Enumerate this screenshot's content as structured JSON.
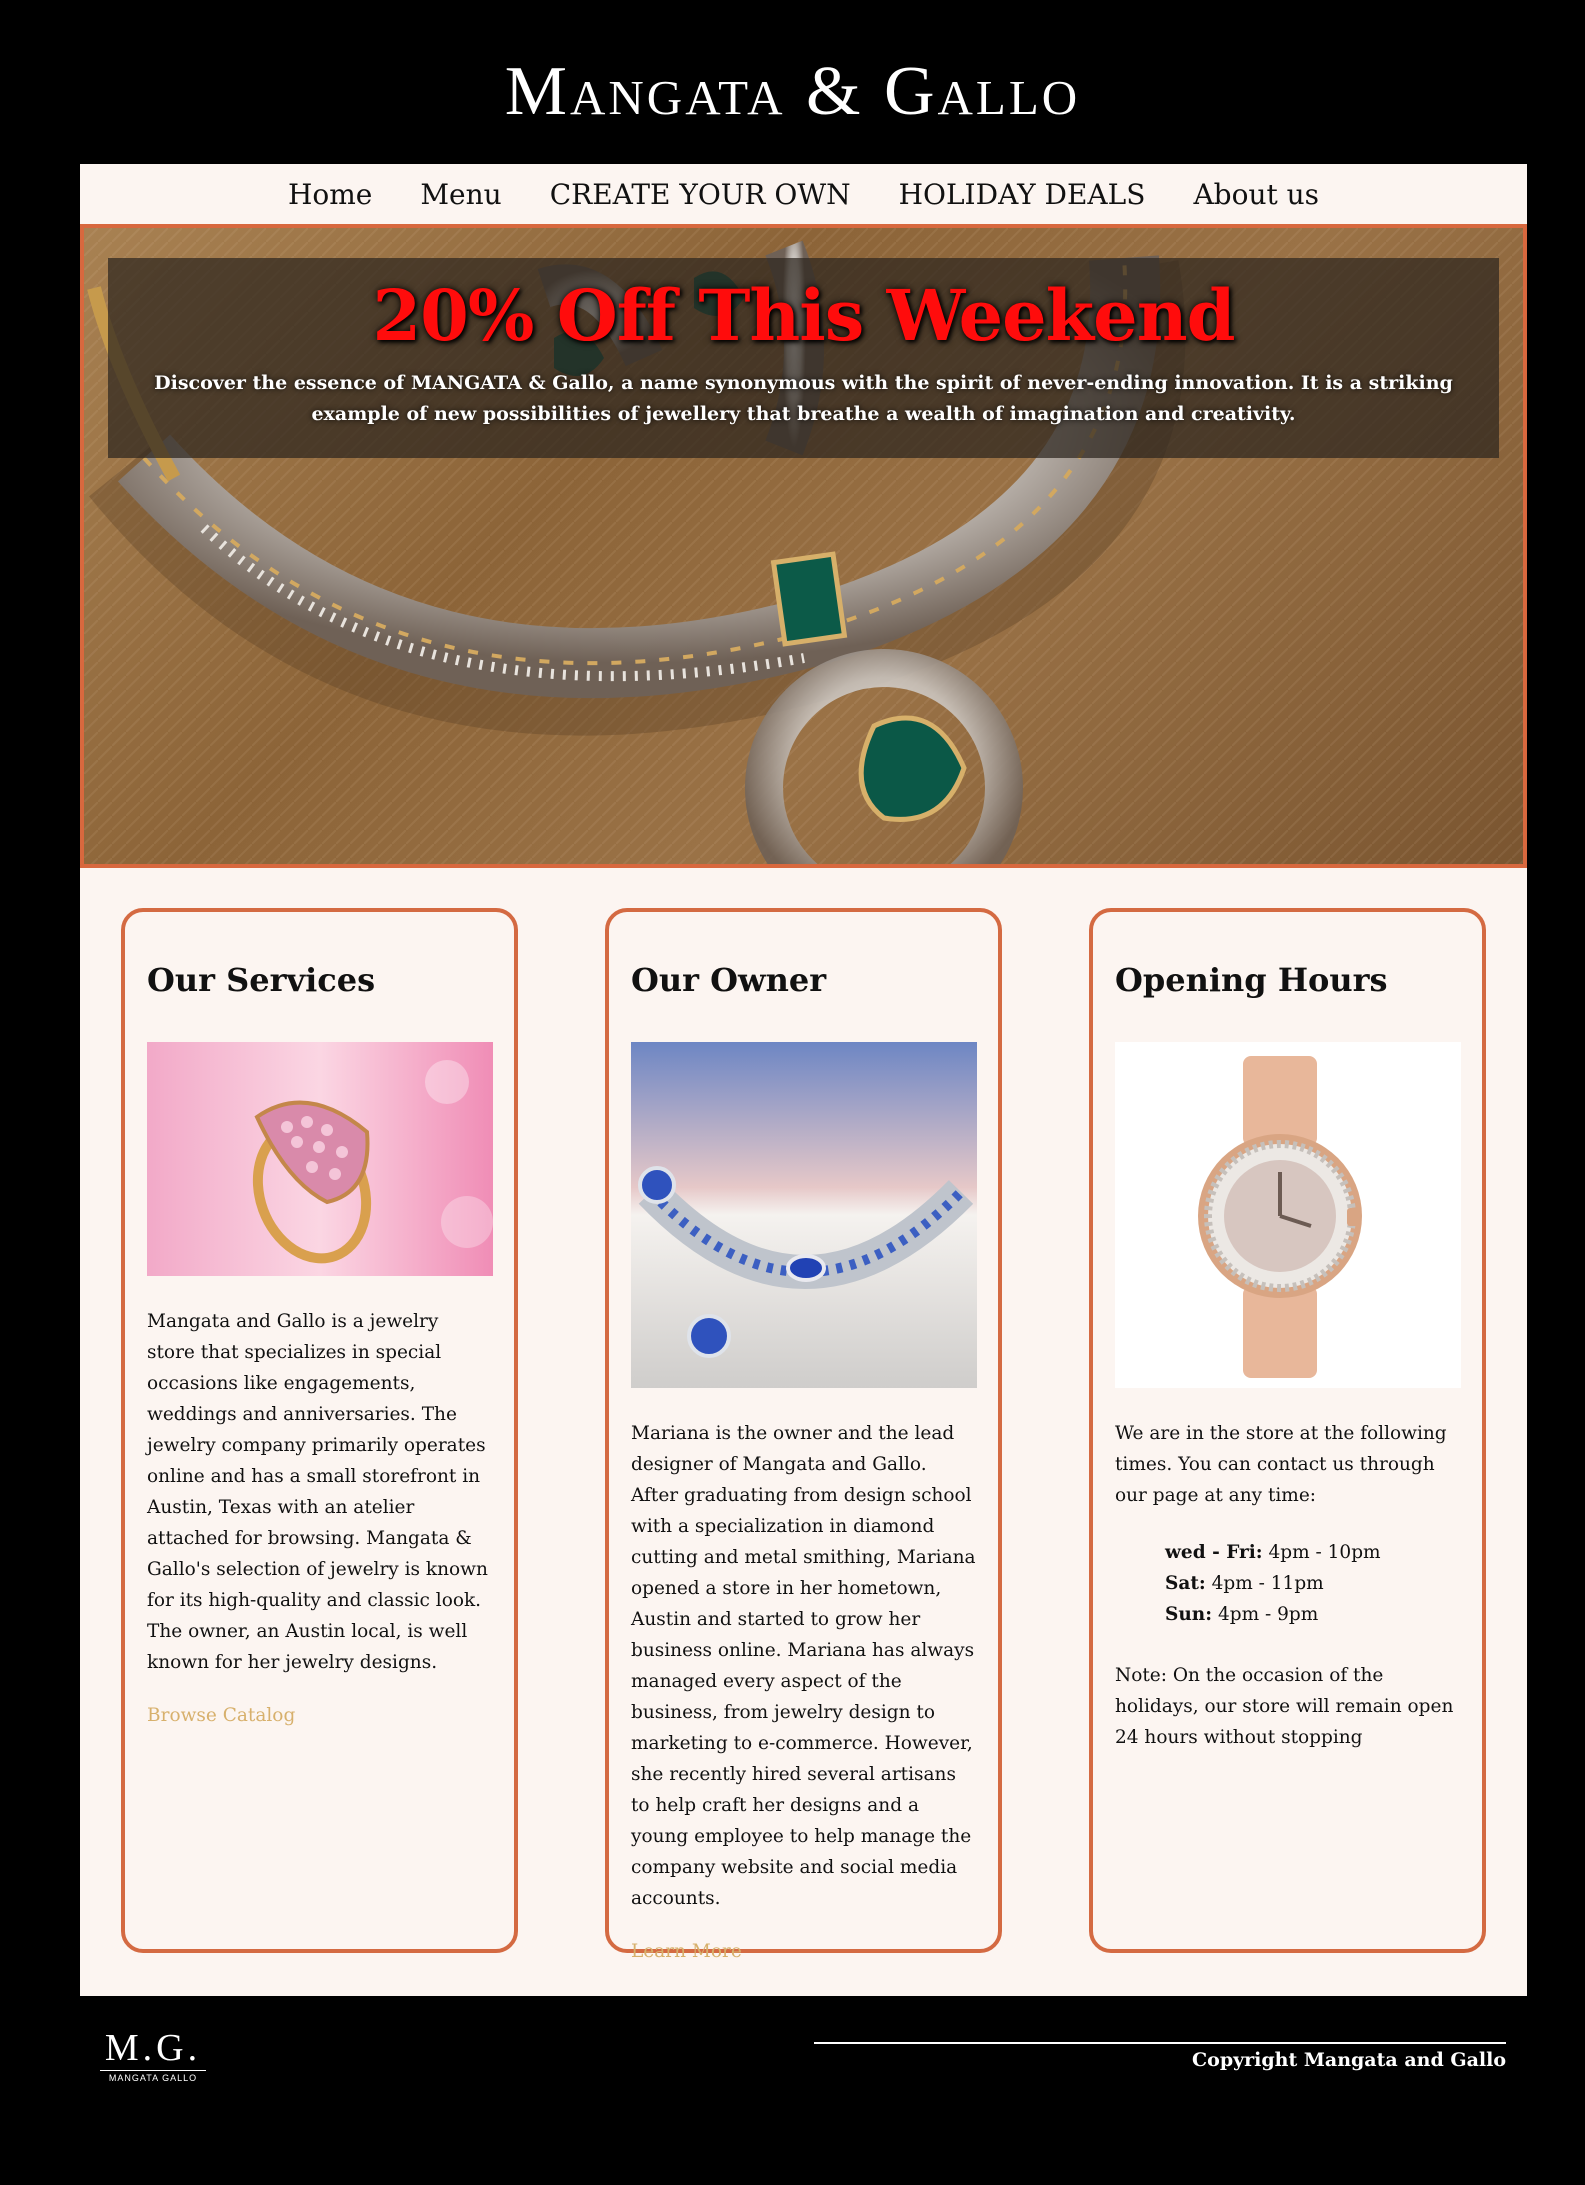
{
  "header": {
    "brand": "Mangata & Gallo"
  },
  "nav": {
    "items": [
      "Home",
      "Menu",
      "CREATE YOUR OWN",
      "HOLIDAY DEALS",
      "About us"
    ]
  },
  "hero": {
    "title": "20% Off This Weekend",
    "text": "Discover the essence of MANGATA & Gallo, a name synonymous with the spirit of never-ending innovation. It is a striking example of new possibilities of jewellery that breathe a wealth of imagination and creativity."
  },
  "cards": {
    "services": {
      "title": "Our Services",
      "text": "Mangata and Gallo is a jewelry store that specializes in special occasions like engagements, weddings and anniversaries. The jewelry company primarily operates online and has a small storefront in Austin, Texas with an atelier attached for browsing. Mangata & Gallo's selection of jewelry is known for its high-quality and classic look. The owner, an Austin local, is well known for her jewelry designs.",
      "link": "Browse Catalog"
    },
    "owner": {
      "title": "Our Owner",
      "text": "Mariana is the owner and the lead designer of Mangata and Gallo. After graduating from design school with a specialization in diamond cutting and metal smithing, Mariana opened a store in her hometown, Austin and started to grow her business online. Mariana has always managed every aspect of the business, from jewelry design to marketing to e-commerce. However, she recently hired several artisans to help craft her designs and a young employee to help manage the company website and social media accounts.",
      "link": "Learn More"
    },
    "hours": {
      "title": "Opening Hours",
      "intro": "We are in the store at the following times. You can contact us through our page at any time:",
      "schedule": [
        {
          "day": "wed - Fri:",
          "time": " 4pm - 10pm"
        },
        {
          "day": "Sat:",
          "time": " 4pm - 11pm"
        },
        {
          "day": "Sun:",
          "time": " 4pm - 9pm"
        }
      ],
      "note": "Note: On the occasion of the holidays, our store will remain open 24 hours without stopping"
    }
  },
  "footer": {
    "logo_main": "M.G.",
    "logo_sub": "MANGATA GALLO",
    "copyright": "Copyright Mangata and Gallo"
  },
  "colors": {
    "accent_border": "#d46a42",
    "link": "#d7b06c",
    "hero_title": "#ff0c0c",
    "page_bg": "#fcf5f1"
  }
}
